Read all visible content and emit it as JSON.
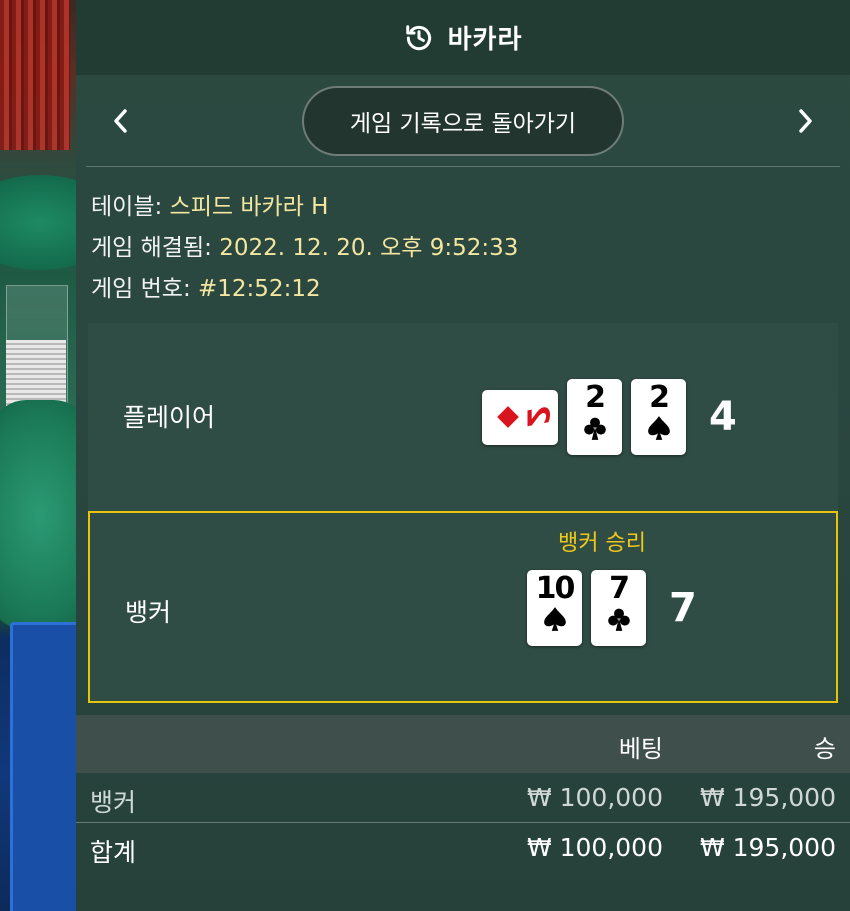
{
  "header": {
    "title": "바카라",
    "icon": "history-icon"
  },
  "nav": {
    "back_button_label": "게임 기록으로 돌아가기",
    "prev_icon": "chevron-left-icon",
    "next_icon": "chevron-right-icon"
  },
  "game_info": {
    "table_label": "테이블:",
    "table_value": "스피드 바카라 H",
    "resolved_label": "게임 해결됨:",
    "resolved_value": "2022. 12. 20. 오후 9:52:33",
    "game_number_label": "게임 번호:",
    "game_number_value": "#12:52:12"
  },
  "player": {
    "label": "플레이어",
    "score": "4",
    "cards": [
      {
        "rank": "2",
        "suit": "diamond",
        "sideways": true
      },
      {
        "rank": "2",
        "suit": "club",
        "sideways": false
      },
      {
        "rank": "2",
        "suit": "spade",
        "sideways": false
      }
    ]
  },
  "banker": {
    "label": "뱅커",
    "win_label": "뱅커 승리",
    "score": "7",
    "cards": [
      {
        "rank": "10",
        "suit": "spade"
      },
      {
        "rank": "7",
        "suit": "club"
      }
    ]
  },
  "bets_table": {
    "headers": {
      "bet": "베팅",
      "win": "승"
    },
    "rows": [
      {
        "label": "뱅커",
        "bet": "₩ 100,000",
        "win": "₩ 195,000"
      }
    ],
    "total": {
      "label": "합계",
      "bet": "₩ 100,000",
      "win": "₩ 195,000"
    }
  },
  "colors": {
    "highlight": "#e6c40c",
    "value_text": "#f3e6a0",
    "red_suit": "#d8141e"
  }
}
